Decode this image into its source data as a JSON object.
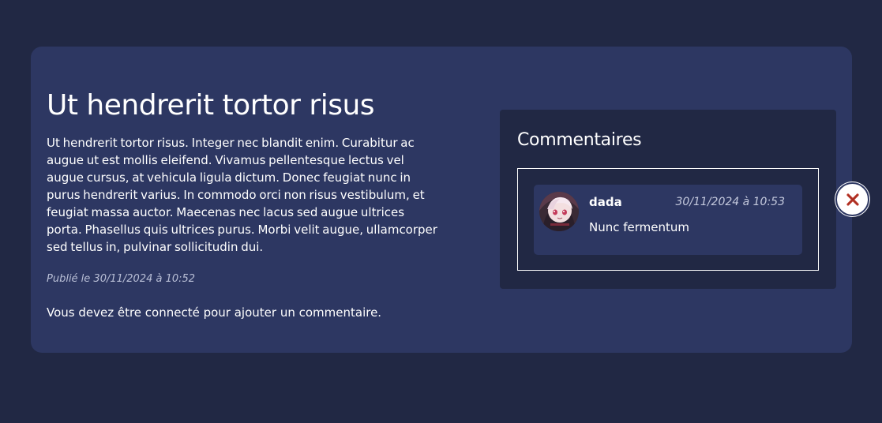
{
  "post": {
    "title": "Ut hendrerit tortor risus",
    "body": "Ut hendrerit tortor risus. Integer nec blandit enim. Curabitur ac augue ut est mollis eleifend. Vivamus pellentesque lectus vel augue cursus, at vehicula ligula dictum. Donec feugiat nunc in purus hendrerit varius. In commodo orci non risus vestibulum, et feugiat massa auctor. Maecenas nec lacus sed augue ultrices porta. Phasellus quis ultrices purus. Morbi velit augue, ullamcorper sed tellus in, pulvinar sollicitudin dui.",
    "published": "Publié le 30/11/2024 à 10:52",
    "login_note": "Vous devez être connecté pour ajouter un commentaire."
  },
  "comments": {
    "title": "Commentaires",
    "items": [
      {
        "author": "dada",
        "date": "30/11/2024 à 10:53",
        "text": "Nunc fermentum",
        "avatar": "avatar-image"
      }
    ]
  },
  "close_button": {
    "icon": "close-icon",
    "color": "#c0392b"
  },
  "colors": {
    "background": "#212844",
    "card": "#2d3762",
    "text": "#ffffff"
  }
}
